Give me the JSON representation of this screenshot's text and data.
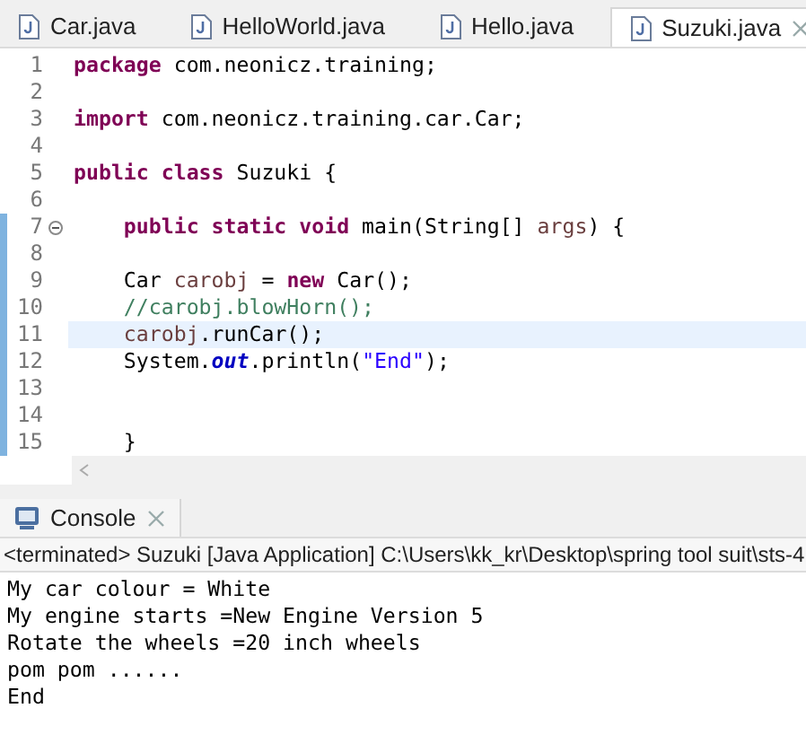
{
  "editor": {
    "tabs": [
      {
        "label": "Car.java",
        "selected": false
      },
      {
        "label": "HelloWorld.java",
        "selected": false
      },
      {
        "label": "Hello.java",
        "selected": false
      },
      {
        "label": "Suzuki.java",
        "selected": true
      }
    ],
    "lines": [
      {
        "number": "1",
        "changed": false,
        "fold": false,
        "highlighted": false,
        "tokens": [
          {
            "kind": "keyword",
            "text": "package"
          },
          {
            "kind": "plain",
            "text": " com.neonicz.training;"
          }
        ]
      },
      {
        "number": "2",
        "changed": false,
        "fold": false,
        "highlighted": false
      },
      {
        "number": "3",
        "changed": false,
        "fold": false,
        "highlighted": false,
        "tokens": [
          {
            "kind": "keyword",
            "text": "import"
          },
          {
            "kind": "plain",
            "text": " com.neonicz.training.car.Car;"
          }
        ]
      },
      {
        "number": "4",
        "changed": false,
        "fold": false,
        "highlighted": false
      },
      {
        "number": "5",
        "changed": false,
        "fold": false,
        "highlighted": false,
        "tokens": [
          {
            "kind": "keyword",
            "text": "public class"
          },
          {
            "kind": "plain",
            "text": " Suzuki {"
          }
        ]
      },
      {
        "number": "6",
        "changed": false,
        "fold": false,
        "highlighted": false
      },
      {
        "number": "7",
        "changed": true,
        "fold": true,
        "highlighted": false,
        "tokens": [
          {
            "kind": "keyword",
            "text": "    public static void"
          },
          {
            "kind": "plain",
            "text": " main(String[] "
          },
          {
            "kind": "param",
            "text": "args"
          },
          {
            "kind": "plain",
            "text": ") {"
          }
        ]
      },
      {
        "number": "8",
        "changed": true,
        "fold": false,
        "highlighted": false
      },
      {
        "number": "9",
        "changed": true,
        "fold": false,
        "highlighted": false,
        "tokens": [
          {
            "kind": "plain",
            "text": "    Car "
          },
          {
            "kind": "param",
            "text": "carobj"
          },
          {
            "kind": "plain",
            "text": " = "
          },
          {
            "kind": "keyword",
            "text": "new"
          },
          {
            "kind": "plain",
            "text": " Car();"
          }
        ]
      },
      {
        "number": "10",
        "changed": true,
        "fold": false,
        "highlighted": false,
        "tokens": [
          {
            "kind": "comment",
            "text": "    //carobj.blowHorn();"
          }
        ]
      },
      {
        "number": "11",
        "changed": true,
        "fold": false,
        "highlighted": true,
        "tokens": [
          {
            "kind": "param",
            "text": "    carobj"
          },
          {
            "kind": "plain",
            "text": ".runCar();"
          }
        ]
      },
      {
        "number": "12",
        "changed": true,
        "fold": false,
        "highlighted": false,
        "tokens": [
          {
            "kind": "plain",
            "text": "    System."
          },
          {
            "kind": "field",
            "text": "out"
          },
          {
            "kind": "plain",
            "text": ".println("
          },
          {
            "kind": "string",
            "text": "\"End\""
          },
          {
            "kind": "plain",
            "text": ");"
          }
        ]
      },
      {
        "number": "13",
        "changed": true,
        "fold": false,
        "highlighted": false
      },
      {
        "number": "14",
        "changed": true,
        "fold": false,
        "highlighted": false
      },
      {
        "number": "15",
        "changed": true,
        "fold": false,
        "highlighted": false,
        "tokens": [
          {
            "kind": "plain",
            "text": "    }"
          }
        ]
      }
    ]
  },
  "console": {
    "tab": {
      "label": "Console",
      "selected": true
    },
    "status": "<terminated> Suzuki [Java Application] C:\\Users\\kk_kr\\Desktop\\spring tool suit\\sts-4",
    "output": [
      "My car colour = White",
      "My engine starts =New Engine Version 5",
      "Rotate the wheels =20 inch wheels",
      "pom pom ......",
      "End"
    ]
  }
}
